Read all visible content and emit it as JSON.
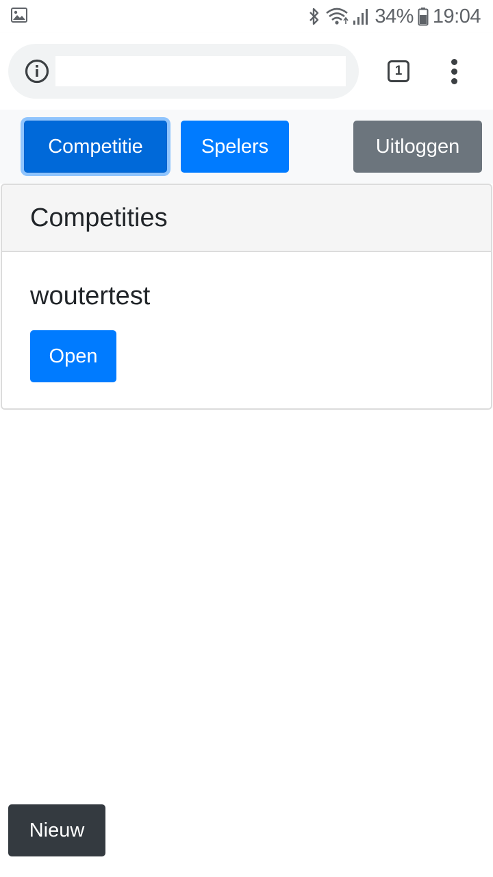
{
  "status_bar": {
    "battery": "34%",
    "time": "19:04",
    "icons": [
      "image-notification-icon",
      "bluetooth-icon",
      "wifi-icon",
      "signal-icon",
      "battery-icon"
    ]
  },
  "browser": {
    "url_value": "",
    "tab_count": "1",
    "icons": [
      "info-icon",
      "tabs-icon",
      "more-vert-icon"
    ]
  },
  "nav": {
    "competition_label": "Competitie",
    "players_label": "Spelers",
    "logout_label": "Uitloggen"
  },
  "card": {
    "header": "Competities",
    "items": [
      {
        "title": "woutertest",
        "open_label": "Open"
      }
    ]
  },
  "footer": {
    "new_label": "Nieuw"
  },
  "colors": {
    "primary": "#007bff",
    "primary_active": "#0069d9",
    "secondary": "#6c757d",
    "dark": "#343a40"
  }
}
